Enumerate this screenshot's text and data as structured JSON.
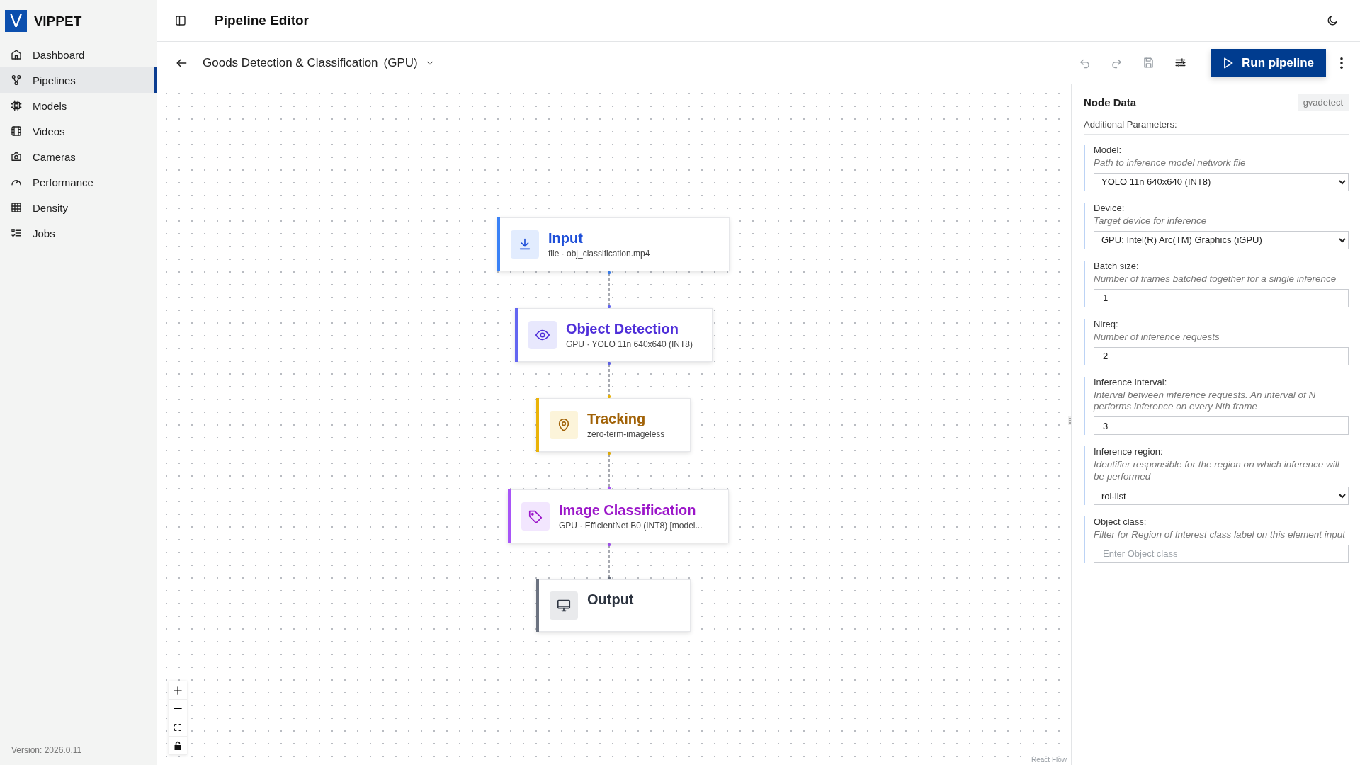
{
  "app": {
    "logo_letter": "V",
    "name": "ViPPET",
    "version": "Version: 2026.0.11"
  },
  "sidebar": {
    "items": [
      {
        "label": "Dashboard",
        "selected": false
      },
      {
        "label": "Pipelines",
        "selected": true
      },
      {
        "label": "Models",
        "selected": false
      },
      {
        "label": "Videos",
        "selected": false
      },
      {
        "label": "Cameras",
        "selected": false
      },
      {
        "label": "Performance",
        "selected": false
      },
      {
        "label": "Density",
        "selected": false
      },
      {
        "label": "Jobs",
        "selected": false
      }
    ]
  },
  "header": {
    "title": "Pipeline Editor"
  },
  "toolbar": {
    "pipeline_name": "Goods Detection & Classification",
    "device": "(GPU)",
    "actions": [
      {
        "kind": "undo",
        "disabled": true
      },
      {
        "kind": "redo",
        "disabled": true
      },
      {
        "kind": "save",
        "disabled": true
      },
      {
        "kind": "settings",
        "disabled": false
      }
    ],
    "run_button": "Run pipeline"
  },
  "canvas": {
    "nodes": [
      {
        "kind": "input",
        "title": "Input",
        "subtitle": "file · obj_classification.mp4",
        "color": "#3b82f6"
      },
      {
        "kind": "detect",
        "title": "Object Detection",
        "subtitle": "GPU · YOLO 11n 640x640 (INT8)",
        "color": "#6366f1"
      },
      {
        "kind": "track",
        "title": "Tracking",
        "subtitle": "zero-term-imageless",
        "color": "#eab308"
      },
      {
        "kind": "classify",
        "title": "Image Classification",
        "subtitle": "GPU · EfficientNet B0 (INT8) [model...",
        "color": "#a855f7"
      },
      {
        "kind": "output",
        "title": "Output",
        "color": "#6b7280"
      }
    ],
    "attribution": "React Flow"
  },
  "node_panel": {
    "title": "Node Data",
    "element": "gvadetect",
    "section": "Additional Parameters:",
    "params": [
      {
        "kind": "select",
        "label": "Model:",
        "description": "Path to inference model network file",
        "value": "YOLO 11n 640x640 (INT8)"
      },
      {
        "kind": "select",
        "label": "Device:",
        "description": "Target device for inference",
        "value": "GPU: Intel(R) Arc(TM) Graphics (iGPU)"
      },
      {
        "kind": "text",
        "label": "Batch size:",
        "description": "Number of frames batched together for a single inference",
        "value": "1"
      },
      {
        "kind": "text",
        "label": "Nireq:",
        "description": "Number of inference requests",
        "value": "2"
      },
      {
        "kind": "text",
        "label": "Inference interval:",
        "description": "Interval between inference requests. An interval of N performs inference on every Nth frame",
        "value": "3"
      },
      {
        "kind": "select",
        "label": "Inference region:",
        "description": "Identifier responsible for the region on which inference will be performed",
        "value": "roi-list"
      },
      {
        "kind": "text",
        "label": "Object class:",
        "description": "Filter for Region of Interest class label on this element input",
        "placeholder": "Enter Object class"
      }
    ]
  }
}
